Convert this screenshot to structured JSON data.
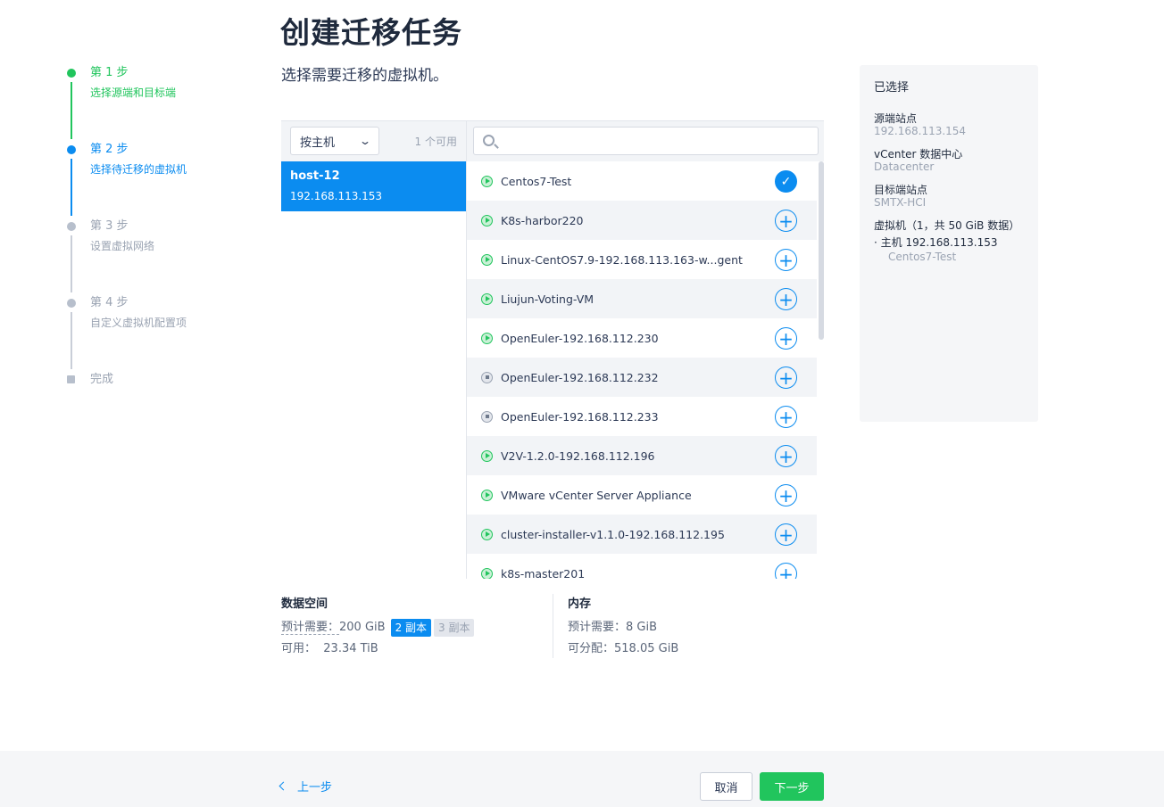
{
  "page": {
    "title": "创建迁移任务",
    "subtitle": "选择需要迁移的虚拟机。"
  },
  "steps": [
    {
      "title": "第 1 步",
      "desc": "选择源端和目标端",
      "state": "done"
    },
    {
      "title": "第 2 步",
      "desc": "选择待迁移的虚拟机",
      "state": "active"
    },
    {
      "title": "第 3 步",
      "desc": "设置虚拟网络",
      "state": "pending"
    },
    {
      "title": "第 4 步",
      "desc": "自定义虚拟机配置项",
      "state": "pending"
    },
    {
      "title": "完成",
      "state": "pending"
    }
  ],
  "selector": {
    "group_by": "按主机",
    "available": "1 个可用",
    "search_placeholder": "",
    "hosts": [
      {
        "name": "host-12",
        "ip": "192.168.113.153",
        "selected": true
      }
    ],
    "vms": [
      {
        "name": "Centos7-Test",
        "status": "running",
        "checked": true
      },
      {
        "name": "K8s-harbor220",
        "status": "running",
        "checked": false
      },
      {
        "name": "Linux-CentOS7.9-192.168.113.163-w...gent",
        "status": "running",
        "checked": false
      },
      {
        "name": "Liujun-Voting-VM",
        "status": "running",
        "checked": false
      },
      {
        "name": "OpenEuler-192.168.112.230",
        "status": "running",
        "checked": false
      },
      {
        "name": "OpenEuler-192.168.112.232",
        "status": "stopped",
        "checked": false
      },
      {
        "name": "OpenEuler-192.168.112.233",
        "status": "stopped",
        "checked": false
      },
      {
        "name": "V2V-1.2.0-192.168.112.196",
        "status": "running",
        "checked": false
      },
      {
        "name": "VMware vCenter Server Appliance",
        "status": "running",
        "checked": false
      },
      {
        "name": "cluster-installer-v1.1.0-192.168.112.195",
        "status": "running",
        "checked": false
      },
      {
        "name": "k8s-master201",
        "status": "running",
        "checked": false
      }
    ]
  },
  "resources": {
    "data_space": {
      "title": "数据空间",
      "required_label": "预计需要：",
      "required_value": "200 GiB",
      "replica2": "2 副本",
      "replica3": "3 副本",
      "available_label": "可用：",
      "available_value": "23.34 TiB"
    },
    "memory": {
      "title": "内存",
      "required_label": "预计需要：",
      "required_value": "8 GiB",
      "allocatable_label": "可分配：",
      "allocatable_value": "518.05 GiB"
    }
  },
  "summary": {
    "heading": "已选择",
    "source_label": "源端站点",
    "source_value": "192.168.113.154",
    "vcenter_label": "vCenter 数据中心",
    "vcenter_value": "Datacenter",
    "target_label": "目标端站点",
    "target_value": "SMTX-HCI",
    "vm_label": "虚拟机（1，共 50 GiB 数据）",
    "host_line": "· 主机 192.168.113.153",
    "vm_line": "Centos7-Test"
  },
  "footer": {
    "back": "上一步",
    "cancel": "取消",
    "next": "下一步"
  },
  "colors": {
    "accent": "#0b8cf0",
    "success": "#21c55d"
  }
}
